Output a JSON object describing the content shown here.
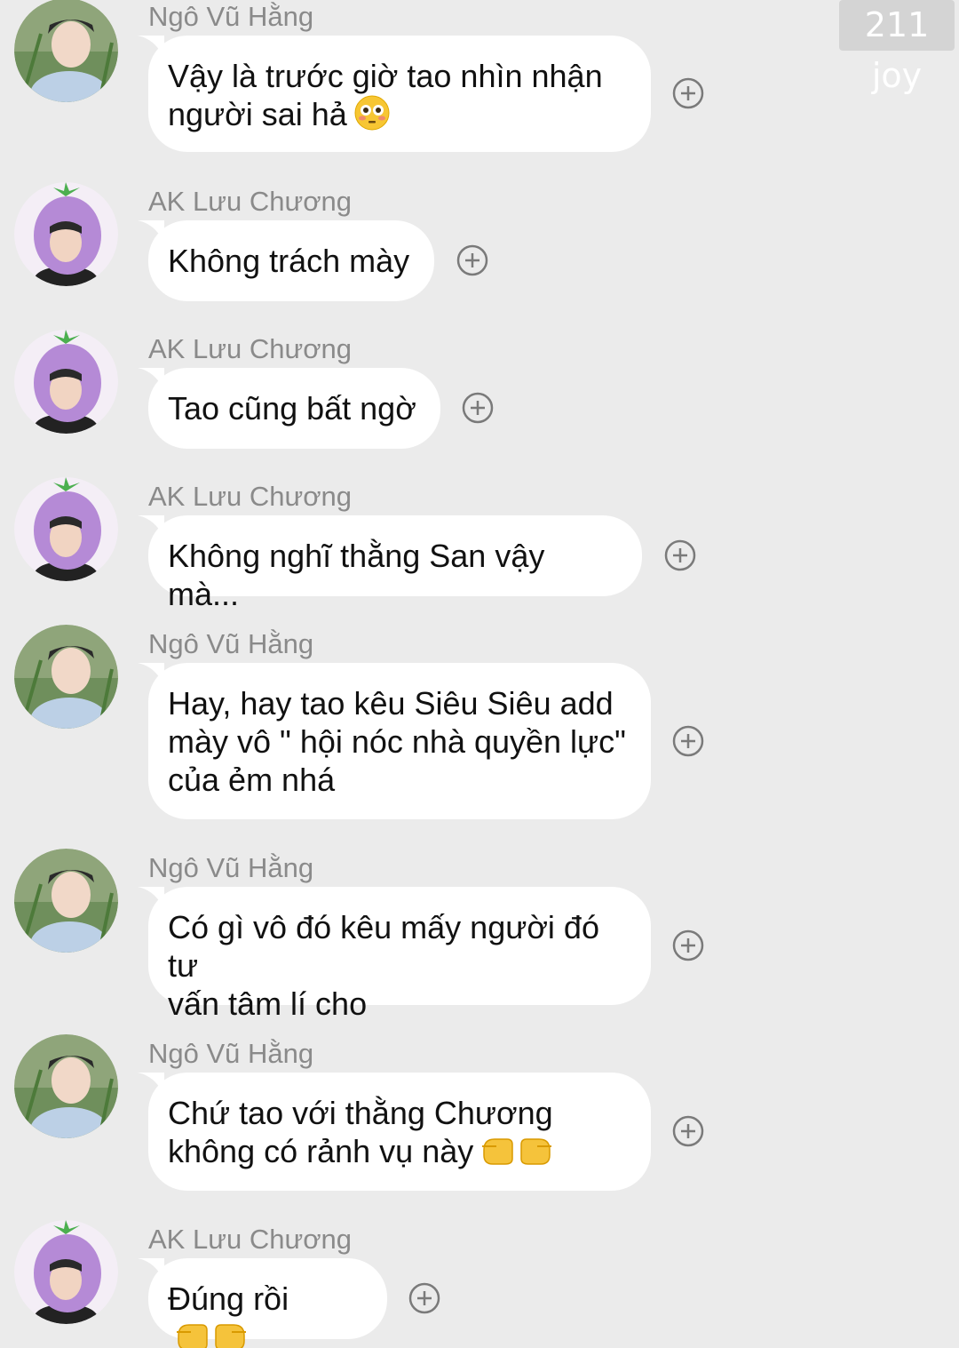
{
  "watermark": "211 joy",
  "messages": [
    {
      "sender": "Ngô Vũ Hằng",
      "text": "Vậy là trước giờ tao nhìn nhận\nngười sai hả",
      "emoji": "flushed-face-emoji",
      "avatar": "avatar-ngo-vu-hang"
    },
    {
      "sender": "AK Lưu Chương",
      "text": "Không trách mày",
      "emoji": "",
      "avatar": "avatar-ak-luu-chuong"
    },
    {
      "sender": "AK Lưu Chương",
      "text": "Tao cũng bất ngờ",
      "emoji": "",
      "avatar": "avatar-ak-luu-chuong"
    },
    {
      "sender": "AK Lưu Chương",
      "text": "Không nghĩ thằng San vậy mà...",
      "emoji": "",
      "avatar": "avatar-ak-luu-chuong"
    },
    {
      "sender": "Ngô Vũ Hằng",
      "text": "Hay, hay tao kêu Siêu Siêu add\nmày vô \" hội nóc nhà quyền lực\"\ncủa ẻm nhá",
      "emoji": "",
      "avatar": "avatar-ngo-vu-hang"
    },
    {
      "sender": "Ngô Vũ Hằng",
      "text": "Có gì vô đó kêu mấy người đó tư\nvấn tâm lí cho",
      "emoji": "",
      "avatar": "avatar-ngo-vu-hang"
    },
    {
      "sender": "Ngô Vũ Hằng",
      "text": "Chứ tao với thằng Chương\nkhông có rảnh vụ này",
      "emoji": "pointing-hands-emoji",
      "avatar": "avatar-ngo-vu-hang"
    },
    {
      "sender": "AK Lưu Chương",
      "text": "Đúng rồi",
      "emoji": "pointing-hands-emoji",
      "avatar": "avatar-ak-luu-chuong"
    }
  ],
  "icons": {
    "reaction": "add-reaction-icon"
  },
  "colors": {
    "background": "#ebebeb",
    "bubble": "#ffffff",
    "sender_name": "#8a8a8a",
    "message_text": "#111111",
    "avatar_eggplant": "#b58ad6"
  }
}
